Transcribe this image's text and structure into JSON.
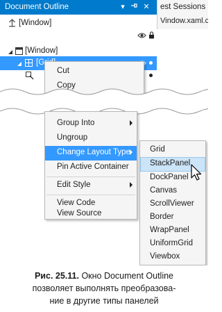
{
  "outline_panel": {
    "title": "Document Outline",
    "tree": [
      {
        "label": "[Window]"
      },
      {
        "label": "[Window]"
      },
      {
        "label": "[Grid]"
      }
    ]
  },
  "adjacent_panel": {
    "tab_label": "est Sessions",
    "file_label": "Vindow.xaml.c"
  },
  "context_menu_top": {
    "items": [
      {
        "label": "Cut"
      },
      {
        "label": "Copy"
      }
    ]
  },
  "context_menu_bottom": {
    "items": [
      {
        "label": "Group Into"
      },
      {
        "label": "Ungroup"
      },
      {
        "label": "Change Layout Type",
        "has_submenu": true,
        "highlighted": true
      },
      {
        "label": "Pin Active Container"
      },
      {
        "label": "Edit Style",
        "has_submenu": true
      },
      {
        "label": "View Code"
      },
      {
        "label": "View Source"
      }
    ]
  },
  "submenu": {
    "items": [
      {
        "label": "Grid"
      },
      {
        "label": "StackPanel",
        "hovered": true
      },
      {
        "label": "DockPanel"
      },
      {
        "label": "Canvas"
      },
      {
        "label": "ScrollViewer"
      },
      {
        "label": "Border"
      },
      {
        "label": "WrapPanel"
      },
      {
        "label": "UniformGrid"
      },
      {
        "label": "Viewbox"
      }
    ]
  },
  "caption": {
    "figure_label": "Рис. 25.11.",
    "text_line1": "Окно Document Outline",
    "text_line2": "позволяет выполнять преобразова-",
    "text_line3": "ние в другие типы панелей"
  },
  "colors": {
    "titlebar": "#007acc",
    "highlight": "#3399ff",
    "hover": "#cce4f7",
    "menu_bg": "#f5f5f5"
  }
}
